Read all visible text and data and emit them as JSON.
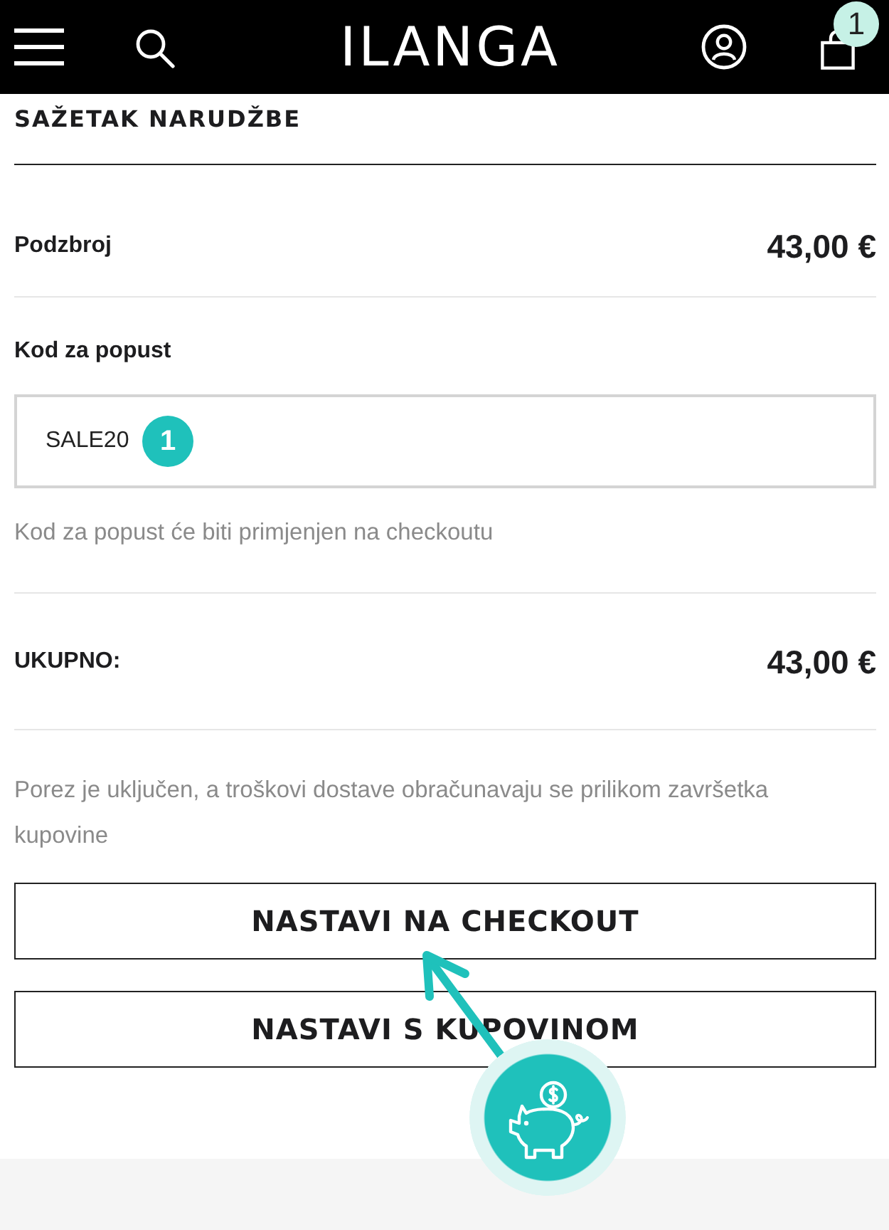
{
  "header": {
    "logo": "ILANGA",
    "cart_count": "1"
  },
  "summary": {
    "title": "SAŽETAK NARUDŽBE",
    "subtotal": {
      "label": "Podzbroj",
      "value": "43,00 €"
    },
    "discount": {
      "label": "Kod za popust",
      "value": "SALE20",
      "marker": "1",
      "hint": "Kod za popust će biti primjenjen na checkoutu"
    },
    "total": {
      "label": "UKUPNO:",
      "value": "43,00 €"
    },
    "note": "Porez je uključen, a troškovi dostave obračunavaju se prilikom završetka kupovine"
  },
  "buttons": [
    {
      "label": "NASTAVI NA CHECKOUT"
    },
    {
      "label": "NASTAVI S KUPOVINOM"
    }
  ]
}
